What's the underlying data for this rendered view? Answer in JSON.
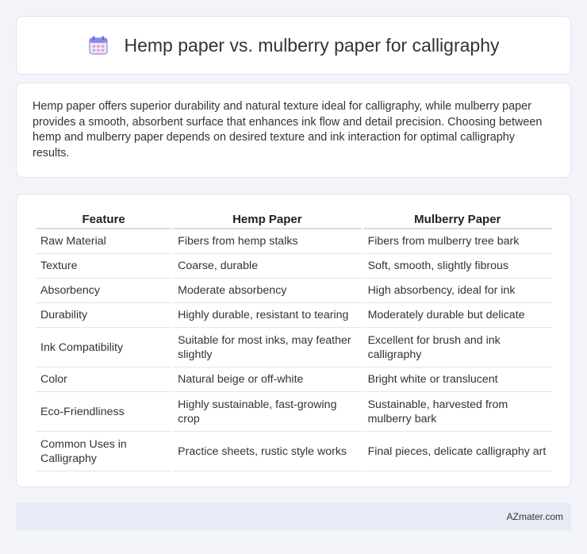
{
  "header": {
    "title": "Hemp paper vs. mulberry paper for calligraphy",
    "icon": "calendar-icon"
  },
  "summary": {
    "text": "Hemp paper offers superior durability and natural texture ideal for calligraphy, while mulberry paper provides a smooth, absorbent surface that enhances ink flow and detail precision. Choosing between hemp and mulberry paper depends on desired texture and ink interaction for optimal calligraphy results."
  },
  "table": {
    "headers": [
      "Feature",
      "Hemp Paper",
      "Mulberry Paper"
    ],
    "rows": [
      {
        "feature": "Raw Material",
        "hemp": "Fibers from hemp stalks",
        "mulberry": "Fibers from mulberry tree bark"
      },
      {
        "feature": "Texture",
        "hemp": "Coarse, durable",
        "mulberry": "Soft, smooth, slightly fibrous"
      },
      {
        "feature": "Absorbency",
        "hemp": "Moderate absorbency",
        "mulberry": "High absorbency, ideal for ink"
      },
      {
        "feature": "Durability",
        "hemp": "Highly durable, resistant to tearing",
        "mulberry": "Moderately durable but delicate"
      },
      {
        "feature": "Ink Compatibility",
        "hemp": "Suitable for most inks, may feather slightly",
        "mulberry": "Excellent for brush and ink calligraphy"
      },
      {
        "feature": "Color",
        "hemp": "Natural beige or off-white",
        "mulberry": "Bright white or translucent"
      },
      {
        "feature": "Eco-Friendliness",
        "hemp": "Highly sustainable, fast-growing crop",
        "mulberry": "Sustainable, harvested from mulberry bark"
      },
      {
        "feature": "Common Uses in Calligraphy",
        "hemp": "Practice sheets, rustic style works",
        "mulberry": "Final pieces, delicate calligraphy art"
      }
    ]
  },
  "footer": {
    "brand": "AZmater.com"
  },
  "colors": {
    "background": "#f2f4fa",
    "card": "#ffffff",
    "footer": "#e6ebf5",
    "icon_accent": "#7b68ee"
  }
}
